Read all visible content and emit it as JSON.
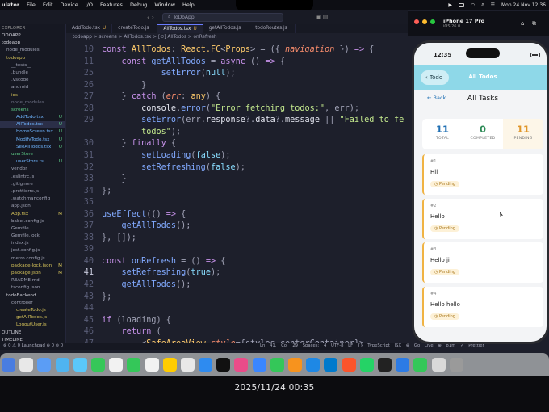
{
  "menubar": {
    "items": [
      "ulator",
      "File",
      "Edit",
      "Device",
      "I/O",
      "Features",
      "Debug",
      "Window",
      "Help"
    ],
    "clock": "Mon 24 Nov  12:36"
  },
  "editor": {
    "search": "ToDoApp",
    "explorer_header": "EXPLORER",
    "tree": [
      {
        "name": "ODOAPP",
        "indent": 0,
        "color": "#cfcfd8",
        "mark": ""
      },
      {
        "name": "todoapp",
        "indent": 0,
        "color": "#cfcfd8",
        "mark": ""
      },
      {
        "name": "node_modules",
        "indent": 1,
        "color": "#9fa2b4",
        "mark": ""
      },
      {
        "name": "todoapp",
        "indent": 1,
        "color": "#d6c35a",
        "mark": ""
      },
      {
        "name": "__tests__",
        "indent": 2,
        "color": "#9fa2b4",
        "mark": ""
      },
      {
        "name": ".bundle",
        "indent": 2,
        "color": "#9fa2b4",
        "mark": ""
      },
      {
        "name": ".vscode",
        "indent": 2,
        "color": "#9fa2b4",
        "mark": ""
      },
      {
        "name": "android",
        "indent": 2,
        "color": "#9fa2b4",
        "mark": ""
      },
      {
        "name": "ios",
        "indent": 2,
        "color": "#d6c35a",
        "mark": ""
      },
      {
        "name": "node_modules",
        "indent": 2,
        "color": "#6e7186",
        "mark": ""
      },
      {
        "name": "screens",
        "indent": 2,
        "color": "#5fd18a",
        "mark": ""
      },
      {
        "name": "AddTodo.tsx",
        "indent": 3,
        "color": "#6fb5ff",
        "mark": "U"
      },
      {
        "name": "AllTodos.tsx",
        "indent": 3,
        "color": "#6fb5ff",
        "mark": "U"
      },
      {
        "name": "HomeScreen.tsx",
        "indent": 3,
        "color": "#6fb5ff",
        "mark": "U"
      },
      {
        "name": "ModifyTodo.tsx",
        "indent": 3,
        "color": "#6fb5ff",
        "mark": "U"
      },
      {
        "name": "SeeAllTodos.tsx",
        "indent": 3,
        "color": "#6fb5ff",
        "mark": "U"
      },
      {
        "name": "userStore",
        "indent": 2,
        "color": "#5fd18a",
        "mark": ""
      },
      {
        "name": "userStore.ts",
        "indent": 3,
        "color": "#6fb5ff",
        "mark": "U"
      },
      {
        "name": "vendor",
        "indent": 2,
        "color": "#9fa2b4",
        "mark": ""
      },
      {
        "name": ".eslintrc.js",
        "indent": 2,
        "color": "#9fa2b4",
        "mark": ""
      },
      {
        "name": ".gitignore",
        "indent": 2,
        "color": "#9fa2b4",
        "mark": ""
      },
      {
        "name": ".prettierrc.js",
        "indent": 2,
        "color": "#9fa2b4",
        "mark": ""
      },
      {
        "name": ".watchmanconfig",
        "indent": 2,
        "color": "#9fa2b4",
        "mark": ""
      },
      {
        "name": "app.json",
        "indent": 2,
        "color": "#9fa2b4",
        "mark": ""
      },
      {
        "name": "App.tsx",
        "indent": 2,
        "color": "#d6c35a",
        "mark": "M"
      },
      {
        "name": "babel.config.js",
        "indent": 2,
        "color": "#9fa2b4",
        "mark": ""
      },
      {
        "name": "Gemfile",
        "indent": 2,
        "color": "#9fa2b4",
        "mark": ""
      },
      {
        "name": "Gemfile.lock",
        "indent": 2,
        "color": "#9fa2b4",
        "mark": ""
      },
      {
        "name": "index.js",
        "indent": 2,
        "color": "#9fa2b4",
        "mark": ""
      },
      {
        "name": "jest.config.js",
        "indent": 2,
        "color": "#9fa2b4",
        "mark": ""
      },
      {
        "name": "metro.config.js",
        "indent": 2,
        "color": "#9fa2b4",
        "mark": ""
      },
      {
        "name": "package-lock.json",
        "indent": 2,
        "color": "#d6c35a",
        "mark": "M"
      },
      {
        "name": "package.json",
        "indent": 2,
        "color": "#d6c35a",
        "mark": "M"
      },
      {
        "name": "README.md",
        "indent": 2,
        "color": "#9fa2b4",
        "mark": ""
      },
      {
        "name": "tsconfig.json",
        "indent": 2,
        "color": "#9fa2b4",
        "mark": ""
      },
      {
        "name": "todoBackend",
        "indent": 1,
        "color": "#cfcfd8",
        "mark": ""
      },
      {
        "name": "controller",
        "indent": 2,
        "color": "#9fa2b4",
        "mark": ""
      },
      {
        "name": "createTodo.js",
        "indent": 3,
        "color": "#d6c35a",
        "mark": ""
      },
      {
        "name": "getAllTodos.js",
        "indent": 3,
        "color": "#d6c35a",
        "mark": ""
      },
      {
        "name": "LogoutUser.js",
        "indent": 3,
        "color": "#d6c35a",
        "mark": ""
      },
      {
        "name": "OUTLINE",
        "indent": 0,
        "color": "#cfcfd8",
        "mark": ""
      },
      {
        "name": "TIMELINE",
        "indent": 0,
        "color": "#cfcfd8",
        "mark": ""
      }
    ],
    "tabs": [
      {
        "label": "AddTodo.tsx",
        "mark": "U",
        "active": false
      },
      {
        "label": "createTodo.js",
        "mark": "",
        "active": false
      },
      {
        "label": "AllTodos.tsx",
        "mark": "U",
        "active": true
      },
      {
        "label": "getAllTodos.js",
        "mark": "",
        "active": false
      },
      {
        "label": "todoRoutes.js",
        "mark": "",
        "active": false
      }
    ],
    "breadcrumb": "todoapp > screens > AllTodos.tsx > [∅] AllTodos > onRefresh",
    "current_line": 41,
    "code": [
      {
        "n": 10,
        "parts": [
          [
            "k",
            "const "
          ],
          [
            "t",
            "AllTodos"
          ],
          [
            "g",
            ": "
          ],
          [
            "t",
            "React.FC"
          ],
          [
            "g",
            "<"
          ],
          [
            "t",
            "Props"
          ],
          [
            "g",
            "> = ({ "
          ],
          [
            "p",
            "navigation"
          ],
          [
            "g",
            " }) "
          ],
          [
            "k",
            "=>"
          ],
          [
            "g",
            " {"
          ]
        ]
      },
      {
        "n": 11,
        "parts": [
          [
            "g",
            "    "
          ],
          [
            "k",
            "const "
          ],
          [
            "f",
            "getAllTodos"
          ],
          [
            "g",
            " = "
          ],
          [
            "k",
            "async"
          ],
          [
            "g",
            " () "
          ],
          [
            "k",
            "=>"
          ],
          [
            "g",
            " {"
          ]
        ]
      },
      {
        "n": 25,
        "parts": [
          [
            "g",
            "            "
          ],
          [
            "f",
            "setError"
          ],
          [
            "g",
            "("
          ],
          [
            "c",
            "null"
          ],
          [
            "g",
            ");"
          ]
        ]
      },
      {
        "n": 26,
        "parts": [
          [
            "g",
            "        }"
          ]
        ]
      },
      {
        "n": 27,
        "parts": [
          [
            "g",
            "    } "
          ],
          [
            "k",
            "catch"
          ],
          [
            "g",
            " ("
          ],
          [
            "p",
            "err"
          ],
          [
            "g",
            ": "
          ],
          [
            "t",
            "any"
          ],
          [
            "g",
            ") {"
          ]
        ]
      },
      {
        "n": 28,
        "parts": [
          [
            "g",
            "        "
          ],
          [
            "v",
            "console"
          ],
          [
            "g",
            "."
          ],
          [
            "f",
            "error"
          ],
          [
            "g",
            "("
          ],
          [
            "s",
            "\"Error fetching todos:\""
          ],
          [
            "g",
            ", err);"
          ]
        ]
      },
      {
        "n": 29,
        "parts": [
          [
            "g",
            "        "
          ],
          [
            "f",
            "setError"
          ],
          [
            "g",
            "(err."
          ],
          [
            "v",
            "response"
          ],
          [
            "g",
            "?."
          ],
          [
            "v",
            "data"
          ],
          [
            "g",
            "?."
          ],
          [
            "v",
            "message"
          ],
          [
            "g",
            " || "
          ],
          [
            "s",
            "\"Failed to fe"
          ]
        ]
      },
      {
        "n": "",
        "parts": [
          [
            "s",
            "        todos\""
          ],
          [
            "g",
            ");"
          ]
        ]
      },
      {
        "n": 30,
        "parts": [
          [
            "g",
            "    } "
          ],
          [
            "k",
            "finally"
          ],
          [
            "g",
            " {"
          ]
        ]
      },
      {
        "n": 31,
        "parts": [
          [
            "g",
            "        "
          ],
          [
            "f",
            "setLoading"
          ],
          [
            "g",
            "("
          ],
          [
            "c",
            "false"
          ],
          [
            "g",
            ");"
          ]
        ]
      },
      {
        "n": 32,
        "parts": [
          [
            "g",
            "        "
          ],
          [
            "f",
            "setRefreshing"
          ],
          [
            "g",
            "("
          ],
          [
            "c",
            "false"
          ],
          [
            "g",
            ");"
          ]
        ]
      },
      {
        "n": 33,
        "parts": [
          [
            "g",
            "    }"
          ]
        ]
      },
      {
        "n": 34,
        "parts": [
          [
            "g",
            "};"
          ]
        ]
      },
      {
        "n": 35,
        "parts": []
      },
      {
        "n": 36,
        "parts": [
          [
            "f",
            "useEffect"
          ],
          [
            "g",
            "(() "
          ],
          [
            "k",
            "=>"
          ],
          [
            "g",
            " {"
          ]
        ]
      },
      {
        "n": 37,
        "parts": [
          [
            "g",
            "    "
          ],
          [
            "f",
            "getAllTodos"
          ],
          [
            "g",
            "();"
          ]
        ]
      },
      {
        "n": 38,
        "parts": [
          [
            "g",
            "}, []);"
          ]
        ]
      },
      {
        "n": 39,
        "parts": []
      },
      {
        "n": 40,
        "parts": [
          [
            "k",
            "const "
          ],
          [
            "f",
            "onRefresh"
          ],
          [
            "g",
            " = () "
          ],
          [
            "k",
            "=>"
          ],
          [
            "g",
            " {"
          ]
        ]
      },
      {
        "n": 41,
        "parts": [
          [
            "g",
            "    "
          ],
          [
            "f",
            "setRefreshing"
          ],
          [
            "g",
            "("
          ],
          [
            "c",
            "true"
          ],
          [
            "g",
            ");"
          ]
        ]
      },
      {
        "n": 42,
        "parts": [
          [
            "g",
            "    "
          ],
          [
            "f",
            "getAllTodos"
          ],
          [
            "g",
            "();"
          ]
        ]
      },
      {
        "n": 43,
        "parts": [
          [
            "g",
            "};"
          ]
        ]
      },
      {
        "n": 44,
        "parts": []
      },
      {
        "n": 45,
        "parts": [
          [
            "k",
            "if"
          ],
          [
            "g",
            " (loading) {"
          ]
        ]
      },
      {
        "n": 46,
        "parts": [
          [
            "g",
            "    "
          ],
          [
            "k",
            "return"
          ],
          [
            "g",
            " ("
          ]
        ]
      },
      {
        "n": 47,
        "parts": [
          [
            "g",
            "        <"
          ],
          [
            "t",
            "SafeAreaView"
          ],
          [
            "g",
            " "
          ],
          [
            "p",
            "style"
          ],
          [
            "g",
            "={styles.centerContainer}>"
          ]
        ]
      }
    ],
    "status_left": "⊗ 0 ⚠ 0   Launchpad   ⊕ 0 ⊛ 0",
    "status_right": "Ln 41, Col 29  Spaces: 4  UTF-8  LF  {} TypeScript JSX  ⊕ Go Live  ⊕ 81m  ✓ Prettier"
  },
  "simulator": {
    "device": "iPhone 17 Pro",
    "os": "iOS 26.0",
    "time": "12:35",
    "nav_back": "Todo",
    "nav_title": "All Todos",
    "page_back": "Back",
    "heading": "All Tasks",
    "stats": [
      {
        "num": "11",
        "label": "TOTAL",
        "color": "#1f6fb3"
      },
      {
        "num": "0",
        "label": "COMPLETED",
        "color": "#2e8b57"
      },
      {
        "num": "11",
        "label": "PENDING",
        "color": "#e0962a"
      }
    ],
    "todos": [
      {
        "id": "#1",
        "title": "Hii",
        "status": "Pending"
      },
      {
        "id": "#2",
        "title": "Hello",
        "status": "Pending"
      },
      {
        "id": "#3",
        "title": "Hello ji",
        "status": "Pending"
      },
      {
        "id": "#4",
        "title": "Hello hello",
        "status": "Pending"
      }
    ]
  },
  "dock_colors": [
    "#4a7de0",
    "#e8e8e8",
    "#5b9df5",
    "#4fb4f0",
    "#5ac8fa",
    "#36c759",
    "#f2f2f2",
    "#34c759",
    "#f2f2f2",
    "#ffcc00",
    "#e8e8e8",
    "#2e8bf0",
    "#111111",
    "#ea4c89",
    "#3a86ff",
    "#34c759",
    "#f7931e",
    "#1e88e5",
    "#007acc",
    "#fb542b",
    "#25d366",
    "#222222",
    "#2c7be5",
    "#34c759",
    "#d9d9d9",
    "#9a9a9a"
  ],
  "photo_timestamp": "2025/11/24 00:35"
}
